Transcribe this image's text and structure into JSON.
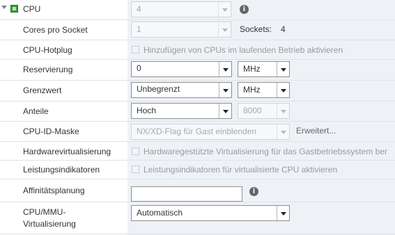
{
  "cpu": {
    "label": "CPU",
    "value": "4",
    "icon": "cpu-chip-icon"
  },
  "cores_per_socket": {
    "label": "Cores pro Socket",
    "value": "1",
    "sockets_label": "Sockets:",
    "sockets_value": "4"
  },
  "hotplug": {
    "label": "CPU-Hotplug",
    "checkbox_label": "Hinzufügen von CPUs im laufenden Betrieb aktivieren",
    "checked": false
  },
  "reservation": {
    "label": "Reservierung",
    "value": "0",
    "unit": "MHz"
  },
  "limit": {
    "label": "Grenzwert",
    "value": "Unbegrenzt",
    "unit": "MHz"
  },
  "shares": {
    "label": "Anteile",
    "value": "Hoch",
    "number": "8000"
  },
  "cpuid_mask": {
    "label": "CPU-ID-Maske",
    "value": "NX/XD-Flag für Gast einblenden",
    "advanced_link": "Erweitert..."
  },
  "hw_virtualization": {
    "label": "Hardwarevirtualisierung",
    "checkbox_label": "Hardwaregestützte Virtualisierung für das Gastbetriebssystem ber",
    "checked": false
  },
  "perf_counters": {
    "label": "Leistungsindikatoren",
    "checkbox_label": "Leistungsindikatoren für virtualisierte CPU aktivieren",
    "checked": false
  },
  "affinity": {
    "label": "Affinitätsplanung",
    "value": ""
  },
  "mmu": {
    "label_line1": "CPU/MMU-",
    "label_line2": "Virtualisierung",
    "value": "Automatisch"
  },
  "colors": {
    "panel_bg": "#eef2f7",
    "row_divider": "#dde3ea",
    "cpu_icon_green": "#3c9a3a"
  }
}
